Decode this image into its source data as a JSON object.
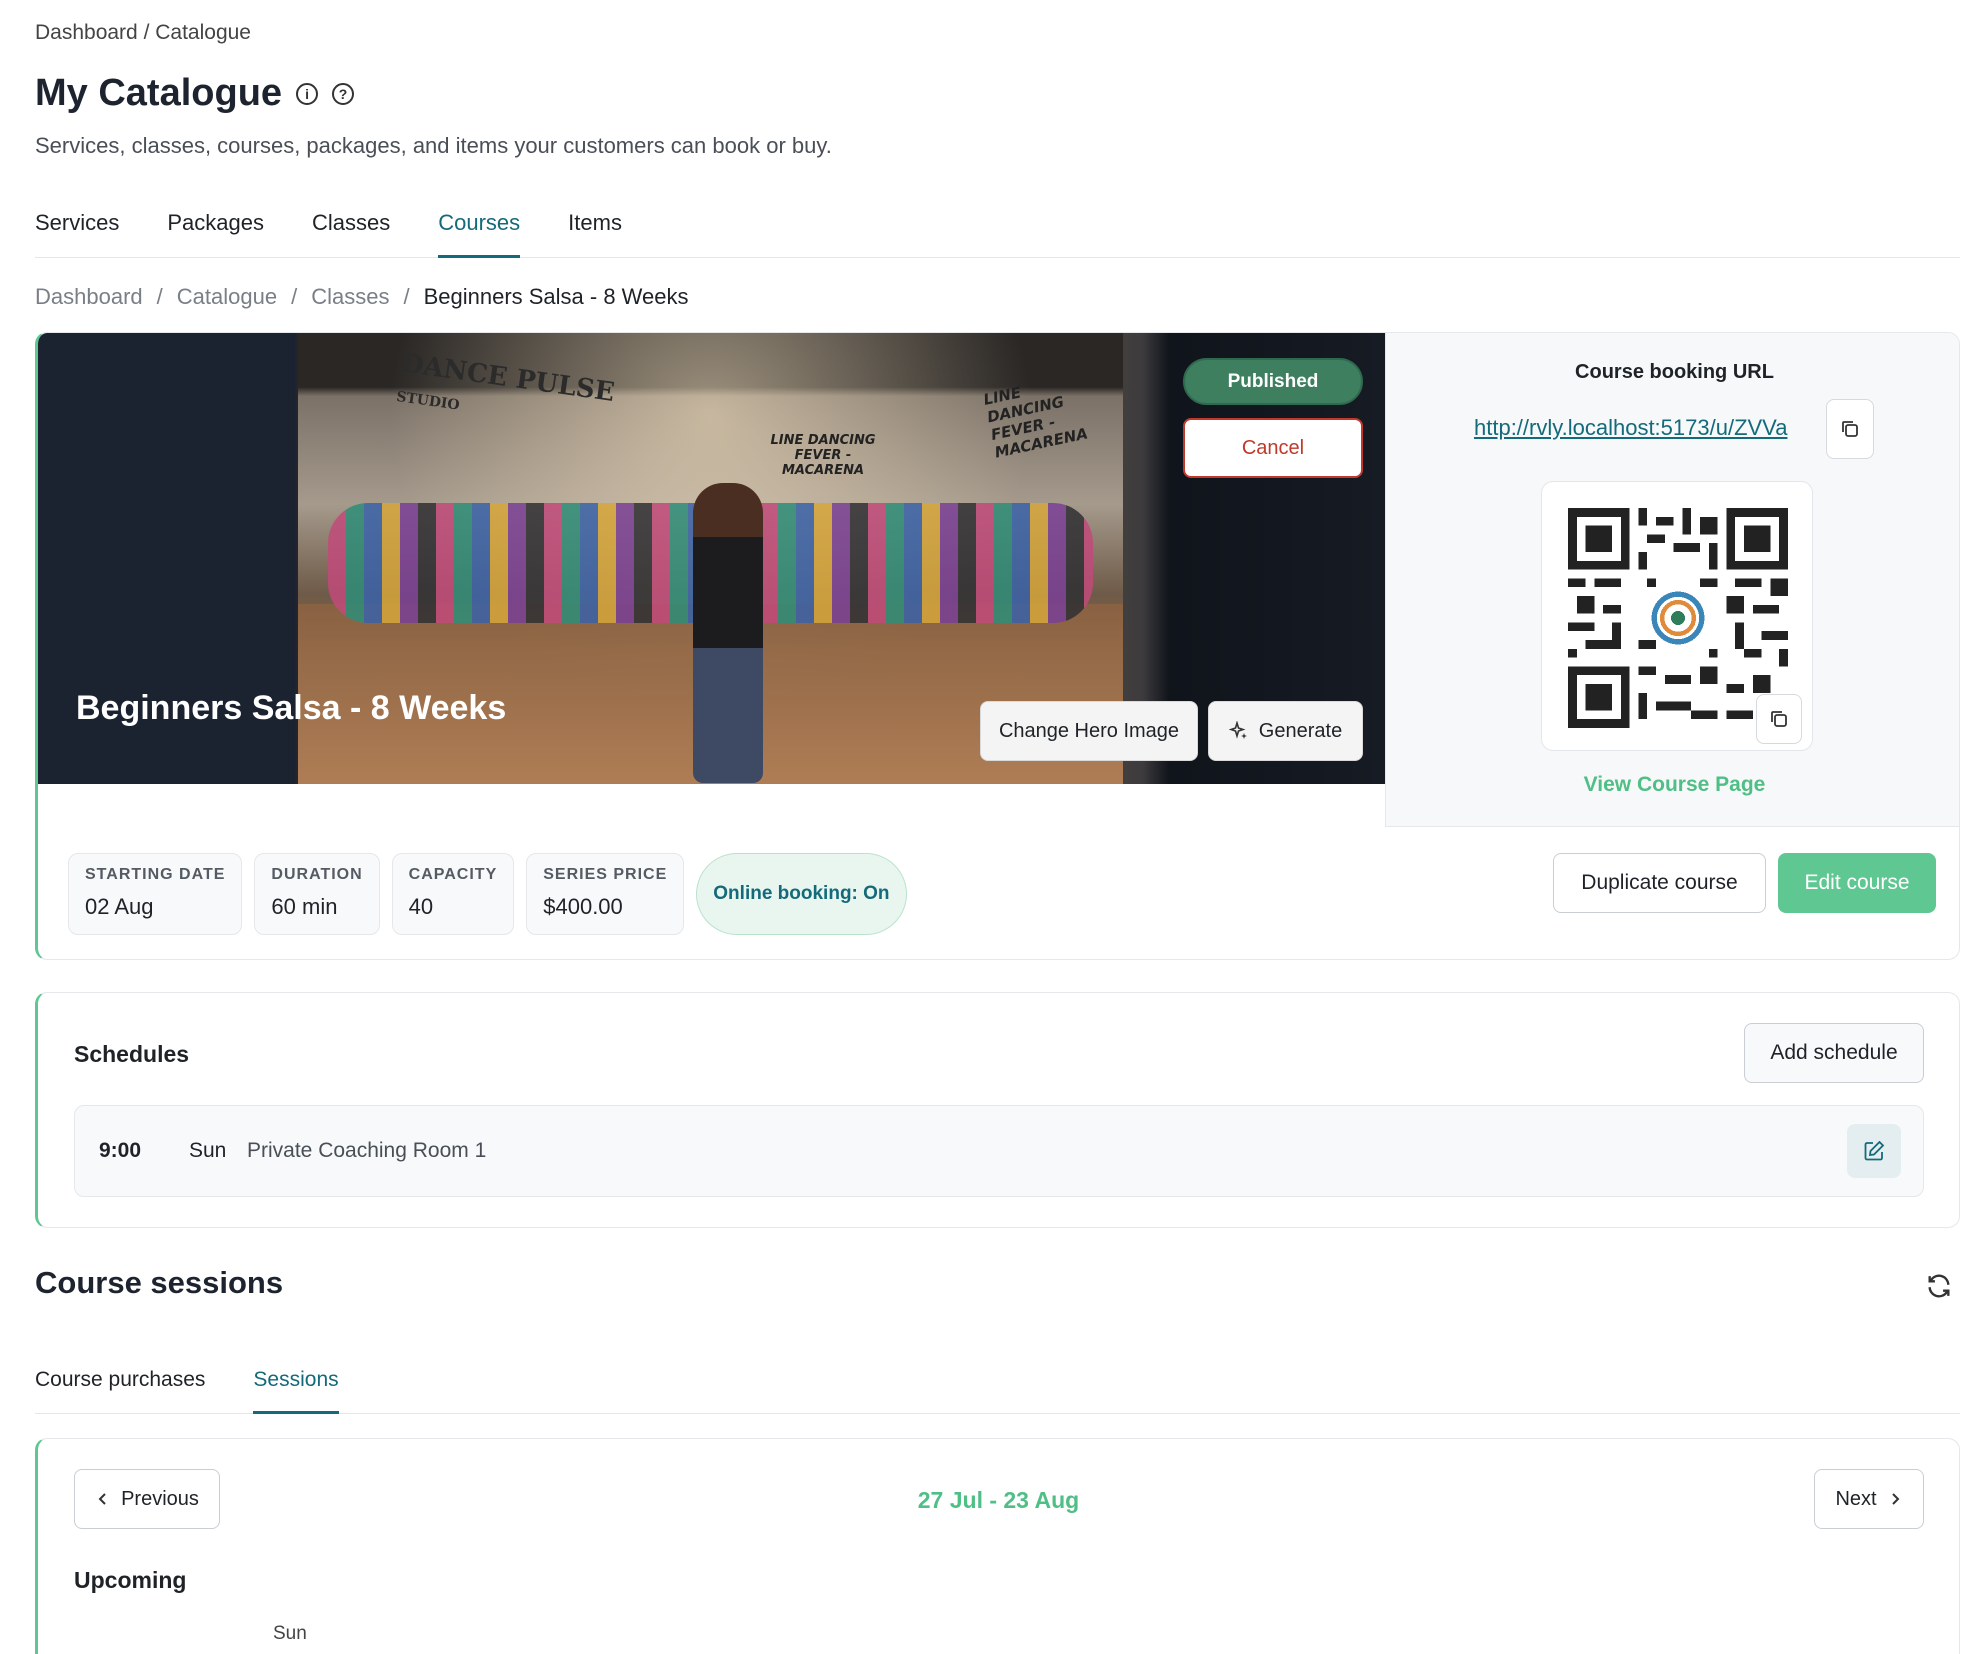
{
  "top_breadcrumb": "Dashboard / Catalogue",
  "page_title": "My Catalogue",
  "subtitle": "Services, classes, courses, packages, and items your customers can book or buy.",
  "tabs": [
    {
      "label": "Services",
      "active": false
    },
    {
      "label": "Packages",
      "active": false
    },
    {
      "label": "Classes",
      "active": false
    },
    {
      "label": "Courses",
      "active": true
    },
    {
      "label": "Items",
      "active": false
    }
  ],
  "breadcrumbs": [
    "Dashboard",
    "Catalogue",
    "Classes",
    "Beginners Salsa - 8 Weeks"
  ],
  "breadcrumb_separator": "/",
  "hero": {
    "title": "Beginners Salsa - 8 Weeks",
    "status_badge": "Published",
    "cancel_label": "Cancel",
    "change_image_label": "Change Hero Image",
    "generate_label": "Generate",
    "photo_sign_main": "DANCE PULSE",
    "photo_sign_sub": "STUDIO",
    "photo_sign_banner": "LINE DANCING FEVER - MACARENA"
  },
  "booking": {
    "label": "Course booking URL",
    "url": "http://rvly.localhost:5173/u/ZVVa",
    "view_page_label": "View Course Page"
  },
  "stats": [
    {
      "key": "STARTING DATE",
      "value": "02 Aug"
    },
    {
      "key": "DURATION",
      "value": "60 min"
    },
    {
      "key": "CAPACITY",
      "value": "40"
    },
    {
      "key": "SERIES PRICE",
      "value": "$400.00"
    }
  ],
  "online_booking": "Online booking: On",
  "actions": {
    "duplicate": "Duplicate course",
    "edit": "Edit course"
  },
  "schedules": {
    "title": "Schedules",
    "add_label": "Add schedule",
    "rows": [
      {
        "time": "9:00",
        "day": "Sun",
        "room": "Private Coaching Room 1"
      }
    ]
  },
  "sessions": {
    "title": "Course sessions",
    "tabs": [
      {
        "label": "Course purchases",
        "active": false
      },
      {
        "label": "Sessions",
        "active": true
      }
    ],
    "prev_label": "Previous",
    "next_label": "Next",
    "range": "27 Jul - 23 Aug",
    "upcoming_label": "Upcoming",
    "day_header": "Sun"
  },
  "colors": {
    "accent": "#5fc792",
    "link": "#146a7a",
    "published": "#3d7f5f",
    "cancel": "#c0392b"
  }
}
